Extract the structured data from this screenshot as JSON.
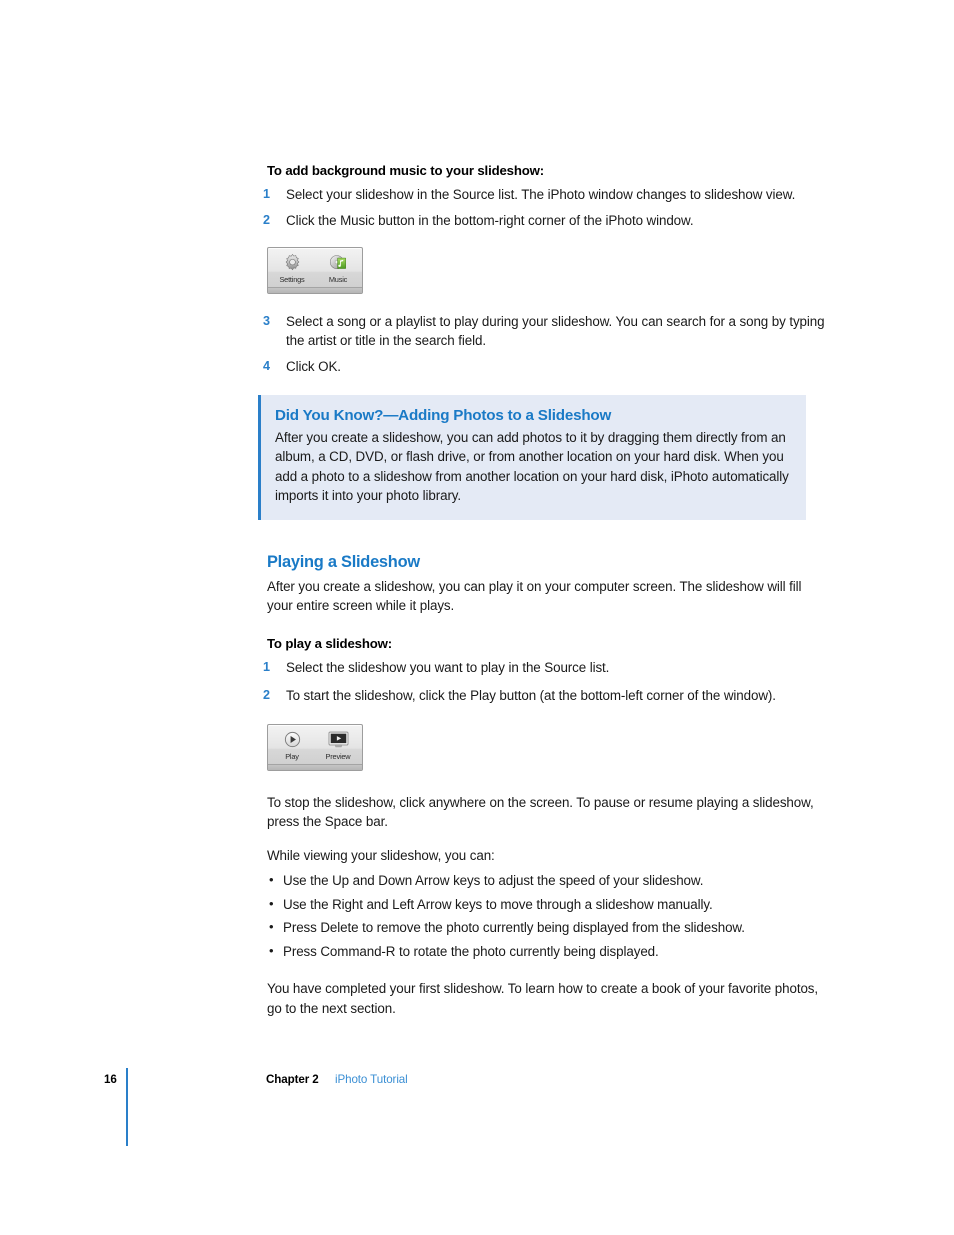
{
  "page": {
    "number": "16",
    "chapter_label": "Chapter 2",
    "doc_title": "iPhoto Tutorial",
    "accent_blue": "#2a7fc9",
    "heading_blue": "#1a7ac6",
    "link_blue": "#3b8fd4",
    "callout_bg": "#e4eaf5"
  },
  "music_procedure": {
    "heading": "To add background music to your slideshow:",
    "steps": [
      {
        "num": "1",
        "text": "Select your slideshow in the Source list. The iPhoto window changes to slideshow view."
      },
      {
        "num": "2",
        "text": "Click the Music button in the bottom-right corner of the iPhoto window."
      }
    ],
    "steps_after": [
      {
        "num": "3",
        "text": "Select a song or a playlist to play during your slideshow. You can search for a song by typing the artist or title in the search field."
      },
      {
        "num": "4",
        "text": "Click OK."
      }
    ]
  },
  "figure_music_toolbar": {
    "name": "slideshow-settings-music-toolbar",
    "buttons": [
      {
        "icon": "gear-icon",
        "label": "Settings"
      },
      {
        "icon": "music-note-disc-icon",
        "label": "Music"
      }
    ]
  },
  "callout": {
    "title": "Did You Know?—Adding Photos to a Slideshow",
    "body": "After you create a slideshow, you can add photos to it by dragging them directly from an album, a CD, DVD, or flash drive, or from another location on your hard disk. When you add a photo to a slideshow from another location on your hard disk, iPhoto automatically imports it into your photo library."
  },
  "playing_section": {
    "heading": "Playing a Slideshow",
    "intro": "After you create a slideshow, you can play it on your computer screen. The slideshow will fill your entire screen while it plays.",
    "proc_heading": "To play a slideshow:",
    "steps": [
      {
        "num": "1",
        "text": "Select the slideshow you want to play in the Source list."
      },
      {
        "num": "2",
        "text": "To start the slideshow, click the Play button (at the bottom-left corner of the window)."
      }
    ]
  },
  "figure_play_toolbar": {
    "name": "slideshow-play-preview-toolbar",
    "buttons": [
      {
        "icon": "play-circle-icon",
        "label": "Play"
      },
      {
        "icon": "preview-screen-icon",
        "label": "Preview"
      }
    ]
  },
  "closing": {
    "stop_paragraph": "To stop the slideshow, click anywhere on the screen. To pause or resume playing a slideshow, press the Space bar.",
    "bullets_intro": "While viewing your slideshow, you can:",
    "bullets": [
      "Use the Up and Down Arrow keys to adjust the speed of your slideshow.",
      "Use the Right and Left Arrow keys to move through a slideshow manually.",
      "Press Delete to remove the photo currently being displayed from the slideshow.",
      "Press Command-R to rotate the photo currently being displayed."
    ],
    "bullet_marker": "•",
    "final_paragraph": "You have completed your first slideshow. To learn how to create a book of your favorite photos, go to the next section."
  }
}
